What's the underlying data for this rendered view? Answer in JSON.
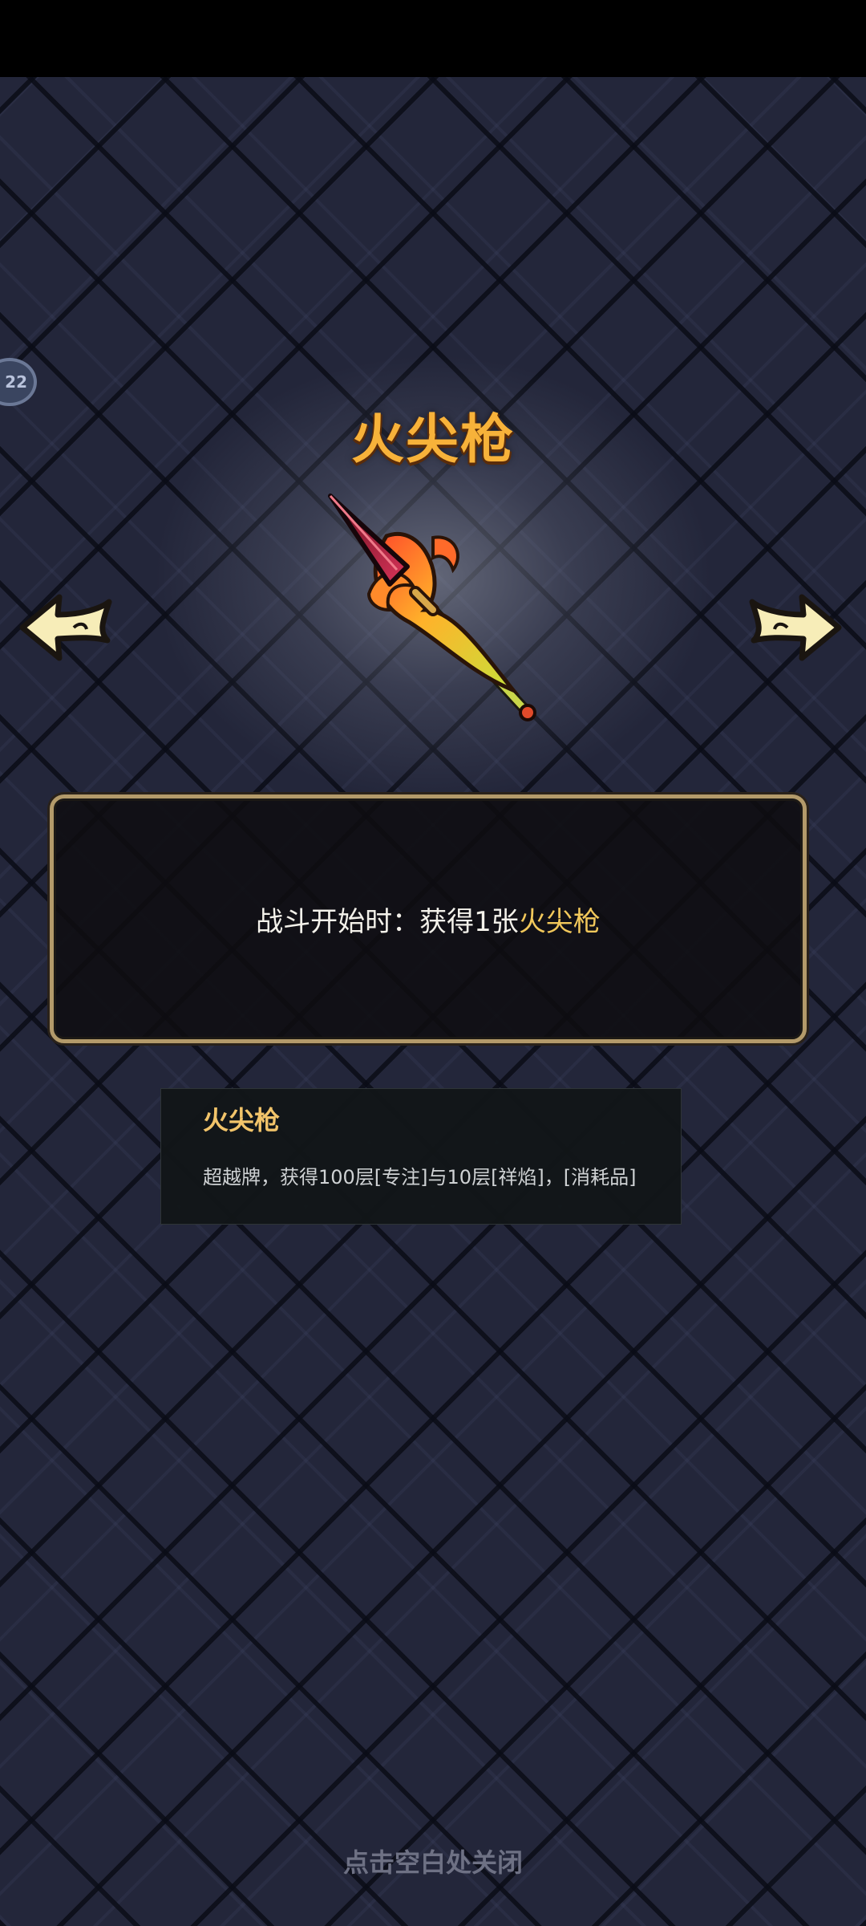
{
  "side_badge": {
    "text": "22"
  },
  "item": {
    "title": "火尖枪",
    "icon": "fire-tipped-spear-icon"
  },
  "navigation": {
    "prev_icon": "left-arrow-icon",
    "next_icon": "right-arrow-icon"
  },
  "description": {
    "prefix": "战斗开始时：获得1张",
    "highlight": "火尖枪"
  },
  "tooltip": {
    "title": "火尖枪",
    "text": "超越牌，获得100层[专注]与10层[祥焰]，[消耗品]"
  },
  "footer": {
    "close_hint": "点击空白处关闭"
  },
  "colors": {
    "title": "#f7b23a",
    "highlight": "#f2c85b",
    "panel_border": "#b39a6a",
    "background": "#23263a"
  }
}
